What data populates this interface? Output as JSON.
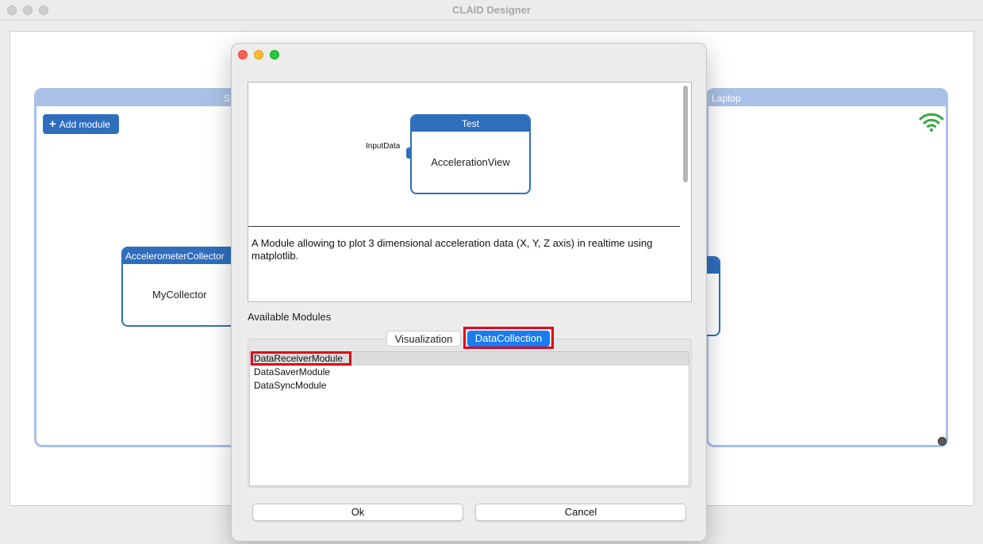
{
  "window": {
    "title": "CLAID Designer"
  },
  "canvas": {
    "hosts": [
      {
        "label": "S",
        "add_module_label": "Add module"
      },
      {
        "label": "Laptop"
      }
    ],
    "modules": [
      {
        "type": "AccelerometerCollector",
        "name": "MyCollector"
      }
    ]
  },
  "dialog": {
    "preview": {
      "module_type": "Test",
      "module_name": "AccelerationView",
      "input_port": "InputData",
      "description": "A Module allowing to plot 3 dimensional acceleration data (X, Y, Z axis) in realtime using matplotlib."
    },
    "available_label": "Available Modules",
    "tabs": [
      {
        "label": "Visualization",
        "active": false
      },
      {
        "label": "DataCollection",
        "active": true
      }
    ],
    "modules": [
      {
        "label": "DataReceiverModule",
        "selected": true
      },
      {
        "label": "DataSaverModule",
        "selected": false
      },
      {
        "label": "DataSyncModule",
        "selected": false
      }
    ],
    "ok_label": "Ok",
    "cancel_label": "Cancel"
  },
  "colors": {
    "accent": "#2f6ebd",
    "tab_active": "#1a7cf0",
    "highlight": "#e0001b",
    "wifi": "#3aa845"
  }
}
